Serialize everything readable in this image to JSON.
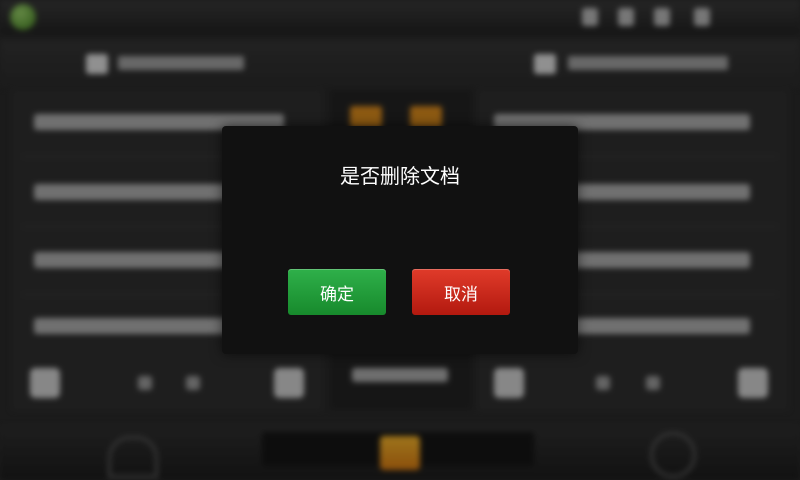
{
  "dialog": {
    "title": "是否删除文档",
    "confirm_label": "确定",
    "cancel_label": "取消"
  },
  "colors": {
    "confirm": "#1f9a36",
    "cancel": "#c8251a",
    "dialog_bg": "#111111"
  },
  "icons": [
    "app-logo-icon",
    "status-icon",
    "folder-icon",
    "home-icon",
    "circle-icon"
  ]
}
